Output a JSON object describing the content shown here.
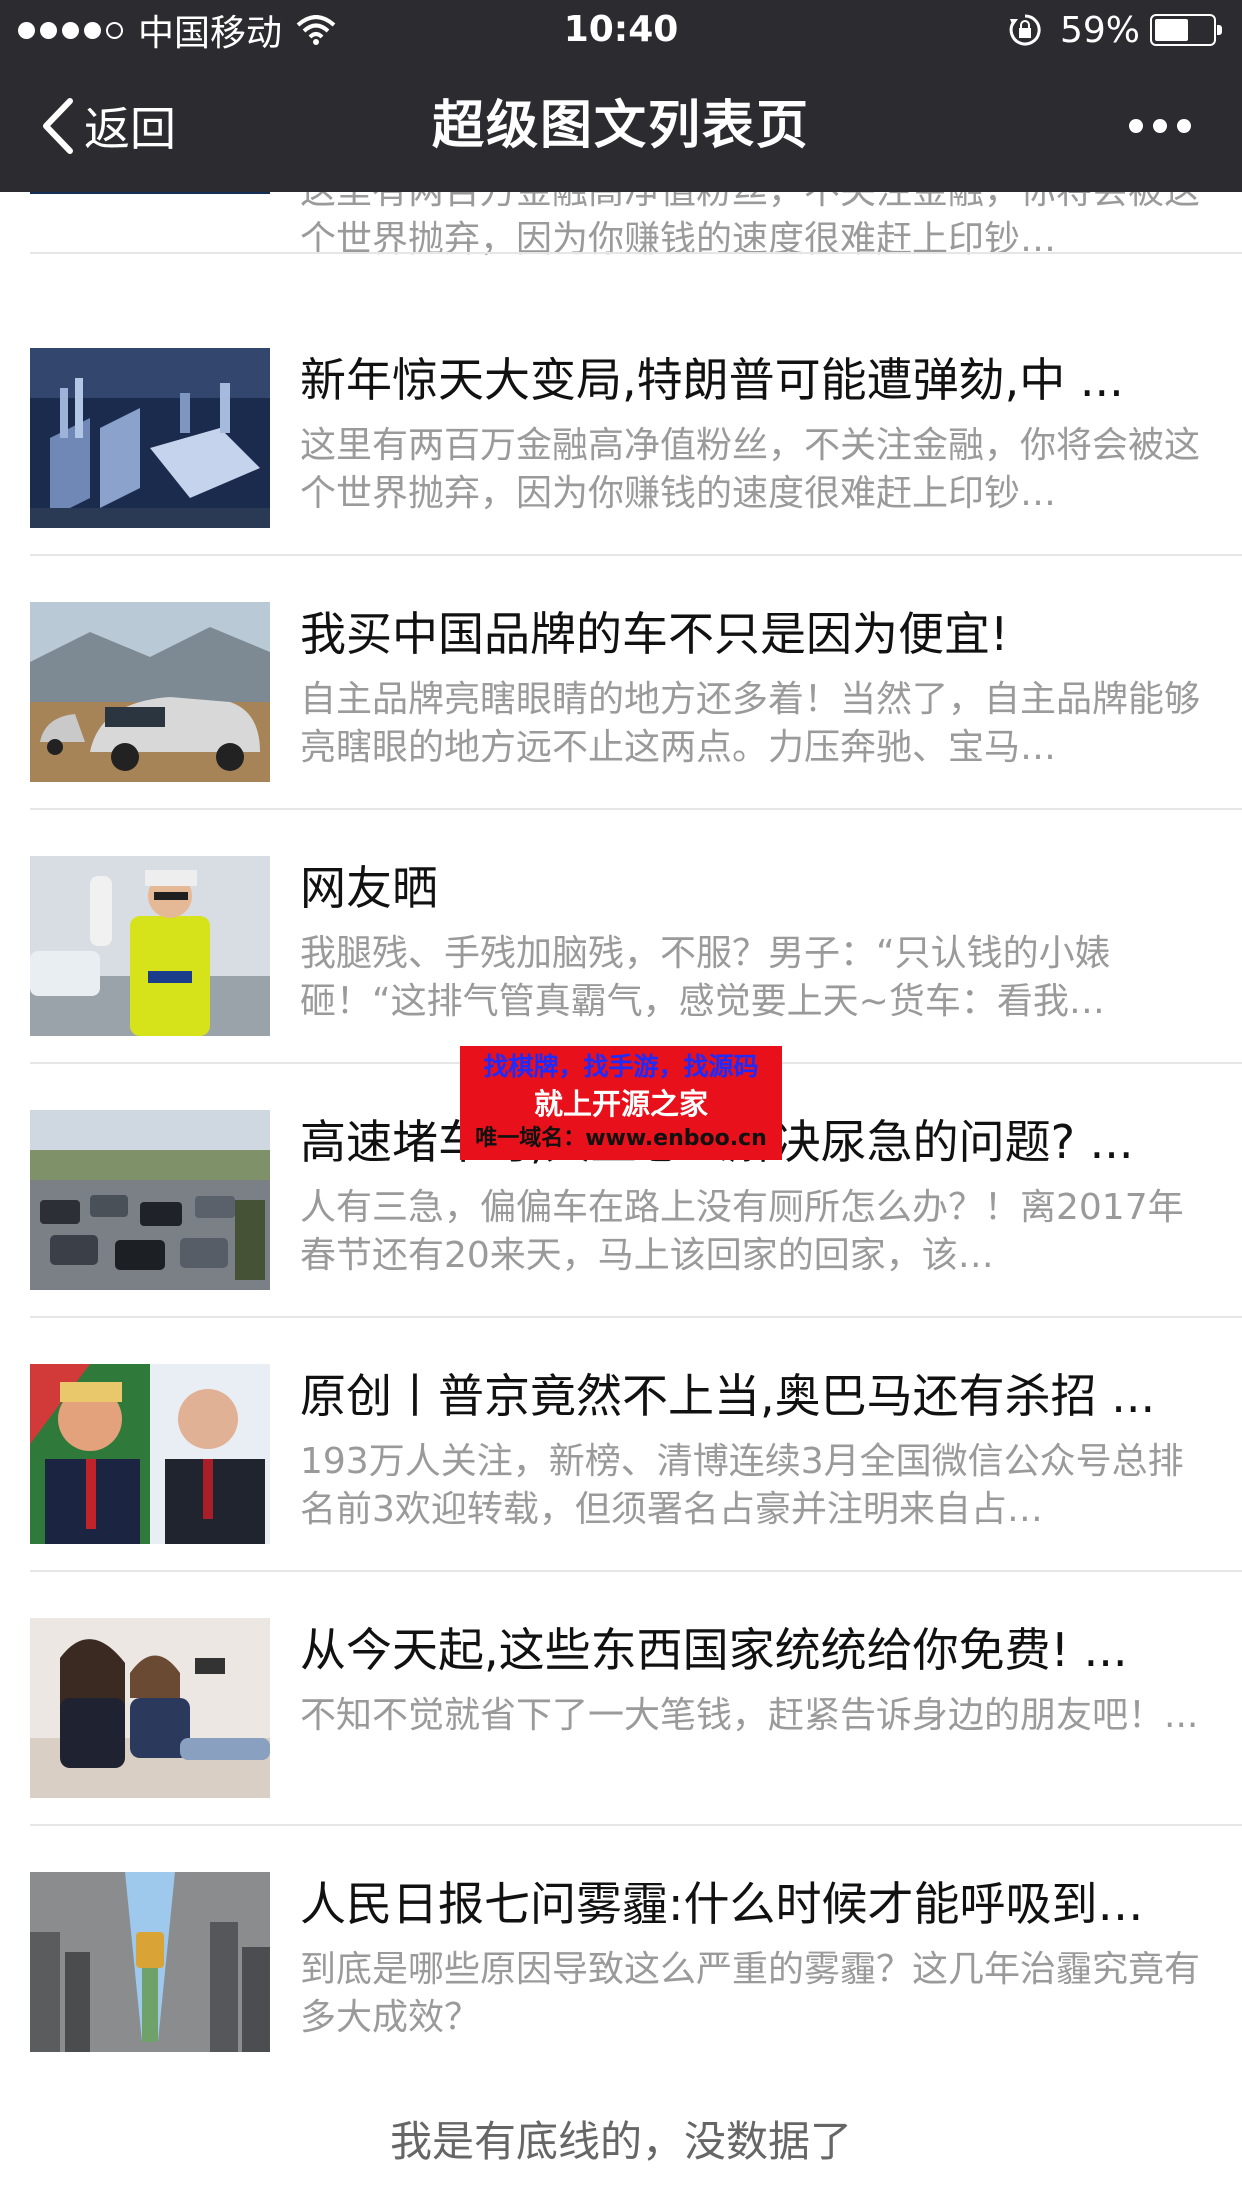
{
  "status_bar": {
    "carrier": "中国移动",
    "time": "10:40",
    "battery": "59%",
    "battery_level": 0.59
  },
  "nav": {
    "back_label": "返回",
    "title": "超级图文列表页"
  },
  "items": [
    {
      "title": "",
      "desc": "这里有两百万金融高净值粉丝，不关注金融，你将会被这个世界抛弃，因为你赚钱的速度很难赶上印钞…",
      "thumb": "city-night-photo"
    },
    {
      "title": "新年惊天大变局,特朗普可能遭弹劾,中 ...",
      "desc": "这里有两百万金融高净值粉丝，不关注金融，你将会被这个世界抛弃，因为你赚钱的速度很难赶上印钞…",
      "thumb": "city-aerial-photo"
    },
    {
      "title": "我买中国品牌的车不只是因为便宜!",
      "desc": "自主品牌亮瞎眼睛的地方还多着！当然了，自主品牌能够亮瞎眼的地方远不止这两点。力压奔驰、宝马…",
      "thumb": "suv-car-photo"
    },
    {
      "title": "网友晒",
      "desc": "我腿残、手残加脑残，不服？男子：“只认钱的小婊砸！“这排气管真霸气，感觉要上天~货车：看我…",
      "thumb": "police-officer-photo"
    },
    {
      "title": "高速堵车时,大型怎么解决尿急的问题? ...",
      "desc": "人有三急，偏偏车在路上没有厕所怎么办？！离2017年春节还有20来天，马上该回家的回家，该…",
      "thumb": "traffic-jam-photo"
    },
    {
      "title": "原创丨普京竟然不上当,奥巴马还有杀招 ...",
      "desc": "193万人关注，新榜、清博连续3月全国微信公众号总排名前3欢迎转载，但须署名占豪并注明来自占…",
      "thumb": "politicians-photo"
    },
    {
      "title": "从今天起,这些东西国家统统给你免费! ...",
      "desc": "不知不觉就省下了一大笔钱，赶紧告诉身边的朋友吧！...",
      "thumb": "selfie-women-photo"
    },
    {
      "title": "人民日报七问雾霾:什么时候才能呼吸到…",
      "desc": "到底是哪些原因导致这么严重的雾霾？这几年治霾究竟有多大成效？",
      "thumb": "smog-zipper-photo"
    }
  ],
  "footer_text": "我是有底线的，没数据了",
  "ad_overlay": {
    "line1": "找棋牌，找手游，找源码",
    "line2": "就上开源之家",
    "line3": "唯一域名：www.enboo.cn"
  }
}
